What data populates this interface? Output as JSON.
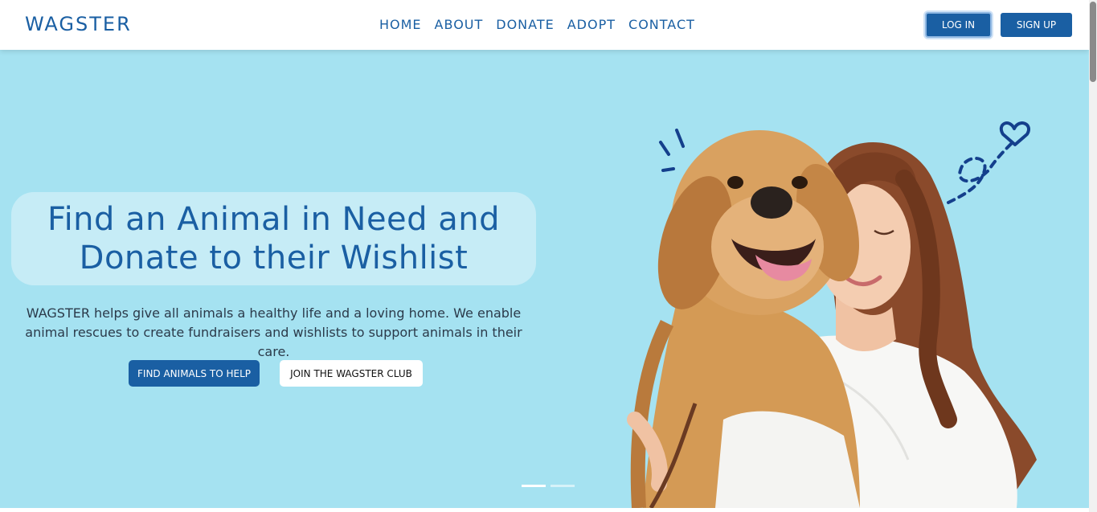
{
  "brand": {
    "name": "WAGSTER"
  },
  "nav": {
    "links": [
      "HOME",
      "ABOUT",
      "DONATE",
      "ADOPT",
      "CONTACT"
    ],
    "login_label": "LOG IN",
    "signup_label": "SIGN UP"
  },
  "hero": {
    "headline": "Find an Animal in Need and Donate to their Wishlist",
    "description": "WAGSTER helps give all animals a healthy life and a loving home. We enable animal rescues to create fundraisers and wishlists to support animals in their care.",
    "primary_cta": "FIND ANIMALS TO HELP",
    "secondary_cta": "JOIN THE WAGSTER CLUB",
    "carousel": {
      "slides": 2,
      "active": 1
    },
    "image": "woman-hugging-golden-retriever"
  },
  "colors": {
    "brand_blue": "#1a5fa3",
    "hero_bg": "#a5e2f1",
    "headline_box": "#c6ecf6",
    "doodle_blue": "#143f8c"
  }
}
